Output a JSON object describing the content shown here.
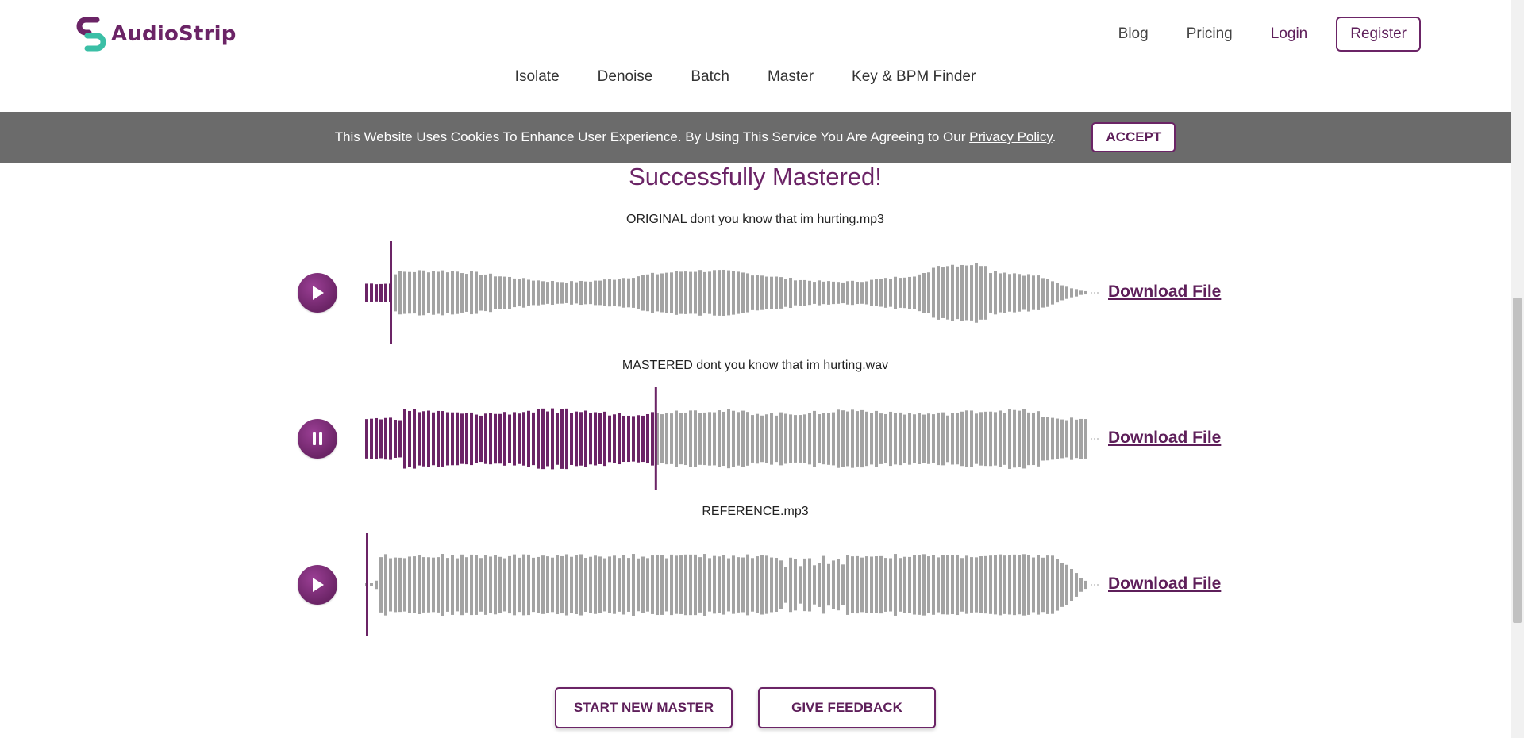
{
  "brand": {
    "name": "AudioStrip",
    "accent": "#6b2466",
    "teal": "#3bbfa6"
  },
  "topnav": {
    "blog": "Blog",
    "pricing": "Pricing",
    "login": "Login",
    "register": "Register"
  },
  "subnav": [
    "Isolate",
    "Denoise",
    "Batch",
    "Master",
    "Key & BPM Finder"
  ],
  "cookie": {
    "message": "This Website Uses Cookies To Enhance User Experience. By Using This Service You Are Agreeing to Our ",
    "privacy_link": "Privacy Policy",
    "suffix": ".",
    "accept": "ACCEPT"
  },
  "title": "Successfully Mastered!",
  "tracks": [
    {
      "label": "ORIGINAL dont you know that im hurting.mp3",
      "state": "paused",
      "progress": 0.034,
      "download": "Download File",
      "icon": "play-icon"
    },
    {
      "label": "MASTERED dont you know that im hurting.wav",
      "state": "playing",
      "progress": 0.4,
      "download": "Download File",
      "icon": "pause-icon"
    },
    {
      "label": "REFERENCE.mp3",
      "state": "paused",
      "progress": 0.0,
      "download": "Download File",
      "icon": "play-icon"
    }
  ],
  "buttons": {
    "new_master": "START NEW MASTER",
    "feedback": "GIVE FEEDBACK"
  },
  "colors": {
    "played": "#6b2466",
    "unplayed": "#a3a3a3",
    "cookie_bg": "#6b6b6b"
  }
}
